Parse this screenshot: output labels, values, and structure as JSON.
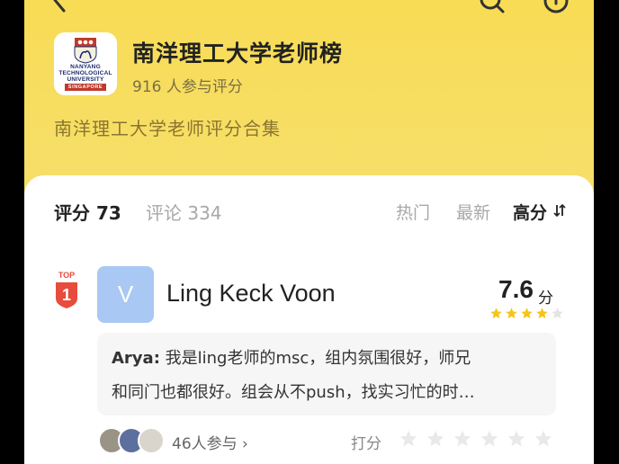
{
  "header": {
    "title": "南洋理工大学老师榜",
    "participants": "916 人参与评分",
    "subtitle": "南洋理工大学老师评分合集",
    "logo_text": [
      "NANYANG",
      "TECHNOLOGICAL",
      "UNIVERSITY"
    ],
    "logo_band": "SINGAPORE"
  },
  "icons": [
    "back-icon",
    "search-icon",
    "more-icon",
    "sort-icon",
    "star-icon",
    "chevron-right-icon"
  ],
  "tabs": {
    "rating": "评分 73",
    "comments": "评论 334"
  },
  "sort": {
    "hot": "热门",
    "new": "最新",
    "high": "高分"
  },
  "entry": {
    "rank_label": "TOP",
    "rank": "1",
    "avatar_letter": "V",
    "name": "Ling Keck Voon",
    "score": "7.6",
    "score_unit": "分",
    "star_rating": 4,
    "comment_author": "Arya:",
    "comment_line1": "我是ling老师的msc，组内氛围很好，师兄",
    "comment_line2": "和同门也都很好。组会从不push，找实习忙的时…",
    "joined": "46人参与",
    "rate_label": "打分"
  },
  "colors": {
    "header_yellow": "#f8dc55",
    "badge_red": "#e74c3c",
    "star_yellow": "#f5c518",
    "avatar_blue": "#a9c8f3"
  }
}
